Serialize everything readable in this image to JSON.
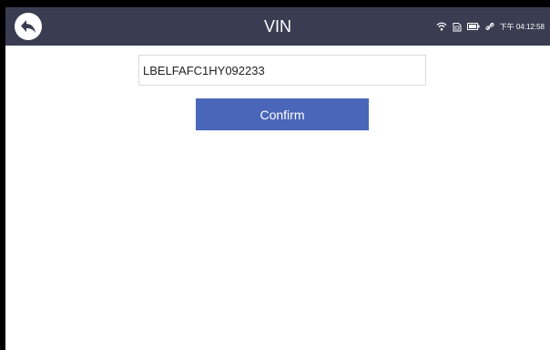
{
  "header": {
    "title": "VIN",
    "back_icon": "back-arrow-icon",
    "background_color": "#3a3d52"
  },
  "status_bar": {
    "time": "下午 04:12:58",
    "icons": [
      "wifi-icon",
      "sd-card-icon",
      "battery-icon",
      "link-icon"
    ]
  },
  "vin_form": {
    "vin_value": "LBELFAFC1HY092233",
    "confirm_label": "Confirm",
    "button_color": "#4a66b8"
  }
}
